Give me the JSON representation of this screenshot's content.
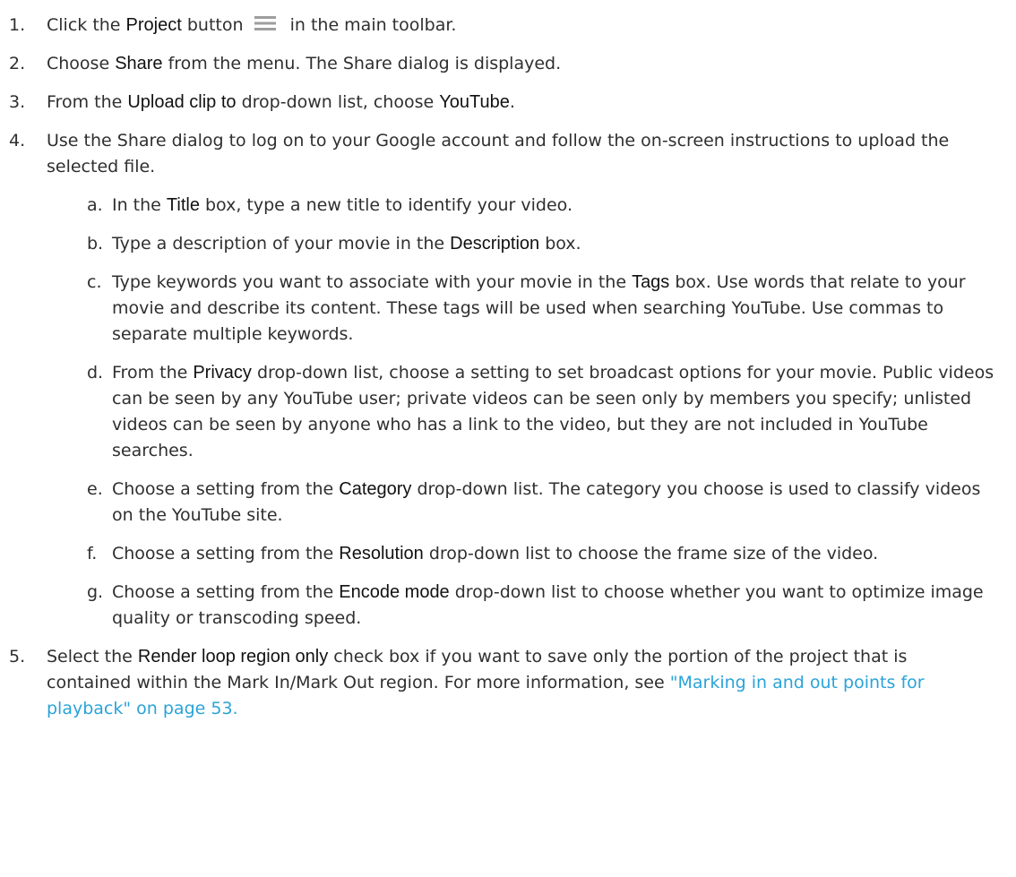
{
  "steps": [
    {
      "num": "1.",
      "parts": [
        {
          "t": "Click the "
        },
        {
          "t": "Project",
          "b": true
        },
        {
          "t": " button "
        },
        {
          "icon": "hamburger-menu-icon"
        },
        {
          "t": " in the main toolbar."
        }
      ]
    },
    {
      "num": "2.",
      "parts": [
        {
          "t": "Choose "
        },
        {
          "t": "Share",
          "b": true
        },
        {
          "t": " from the menu. The Share dialog is displayed."
        }
      ]
    },
    {
      "num": "3.",
      "parts": [
        {
          "t": "From the "
        },
        {
          "t": "Upload clip to",
          "b": true
        },
        {
          "t": " drop-down list, choose "
        },
        {
          "t": "YouTube",
          "b": true
        },
        {
          "t": "."
        }
      ]
    },
    {
      "num": "4.",
      "parts": [
        {
          "t": "Use the Share dialog to log on to your Google account and follow the on-screen instructions to upload the selected file."
        }
      ],
      "substeps": [
        {
          "letter": "a.",
          "parts": [
            {
              "t": "In the "
            },
            {
              "t": "Title",
              "b": true
            },
            {
              "t": " box, type a new title to identify your video."
            }
          ]
        },
        {
          "letter": "b.",
          "parts": [
            {
              "t": "Type a description of your movie in the "
            },
            {
              "t": "Description",
              "b": true
            },
            {
              "t": " box."
            }
          ]
        },
        {
          "letter": "c.",
          "parts": [
            {
              "t": "Type keywords you want to associate with your movie in the "
            },
            {
              "t": "Tags",
              "b": true
            },
            {
              "t": " box. Use words that relate to your movie and describe its content. These tags will be used when searching YouTube. Use commas to separate multiple keywords."
            }
          ]
        },
        {
          "letter": "d.",
          "parts": [
            {
              "t": "From the "
            },
            {
              "t": "Privacy",
              "b": true
            },
            {
              "t": " drop-down list, choose a setting to set broadcast options for your movie. Public videos can be seen by any YouTube user; private videos can be seen only by members you specify; unlisted videos can be seen by anyone who has a link to the video, but they are not included in YouTube searches."
            }
          ]
        },
        {
          "letter": "e.",
          "parts": [
            {
              "t": "Choose a setting from the "
            },
            {
              "t": "Category",
              "b": true
            },
            {
              "t": " drop-down list. The category you choose is used to classify videos on the YouTube site."
            }
          ]
        },
        {
          "letter": "f.",
          "parts": [
            {
              "t": "Choose a setting from the "
            },
            {
              "t": "Resolution",
              "b": true
            },
            {
              "t": " drop-down list to choose the frame size of the video."
            }
          ]
        },
        {
          "letter": "g.",
          "parts": [
            {
              "t": "Choose a setting from the "
            },
            {
              "t": "Encode mode",
              "b": true
            },
            {
              "t": " drop-down list to choose whether you want to optimize image quality or transcoding speed."
            }
          ]
        }
      ]
    },
    {
      "num": "5.",
      "parts": [
        {
          "t": "Select the "
        },
        {
          "t": "Render loop region only",
          "b": true
        },
        {
          "t": " check box if you want to save only the portion of the project that is contained within the Mark In/Mark Out region. For more information, see "
        },
        {
          "t": "\"Marking in and out points for playback\" on page 53.",
          "link": true
        }
      ]
    }
  ],
  "colors": {
    "text": "#2f2f2f",
    "ui_label": "#111111",
    "link": "#2aa3d8",
    "icon": "#9e9e9e"
  }
}
